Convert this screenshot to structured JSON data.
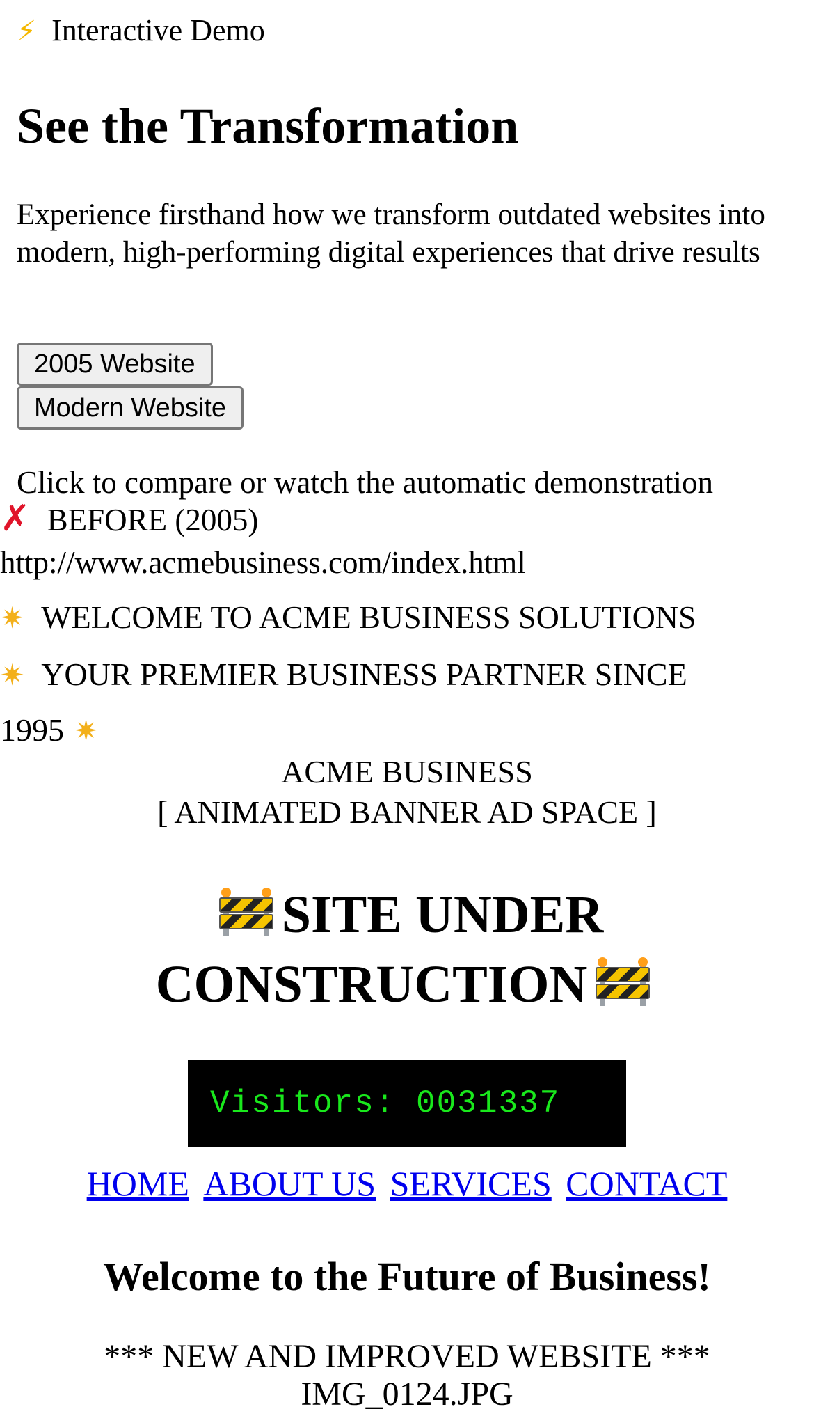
{
  "demo_badge": {
    "icon": "lightning-icon",
    "label": "Interactive Demo"
  },
  "hero": {
    "title": "See the Transformation",
    "subtitle": "Experience firsthand how we transform outdated websites into modern, high-performing digital experiences that drive results"
  },
  "buttons": {
    "old_label": "2005 Website",
    "modern_label": "Modern Website"
  },
  "hint": "Click to compare or watch the automatic demonstration",
  "before_label": "BEFORE (2005)",
  "old_site": {
    "url": "http://www.acmebusiness.com/index.html",
    "marquee_line1": "WELCOME TO ACME BUSINESS SOLUTIONS",
    "marquee_line2": "YOUR PREMIER BUSINESS PARTNER SINCE",
    "marquee_line3": "1995",
    "banner_name": "ACME BUSINESS",
    "banner_ad": "[ ANIMATED BANNER AD SPACE ]",
    "construction_line1": "SITE UNDER",
    "construction_line2": "CONSTRUCTION",
    "visitor_counter": "Visitors: 0031337",
    "nav": [
      "HOME",
      "ABOUT US",
      "SERVICES",
      "CONTACT"
    ],
    "welcome_heading": "Welcome to the Future of Business!",
    "improved_text": "*** NEW AND IMPROVED WEBSITE ***",
    "image_caption": "IMG_0124.JPG"
  },
  "colors": {
    "counter_bg": "#000000",
    "counter_text": "#19e81c",
    "link": "#0000ee",
    "error_red": "#e0142a",
    "lightning": "#f5b800"
  }
}
